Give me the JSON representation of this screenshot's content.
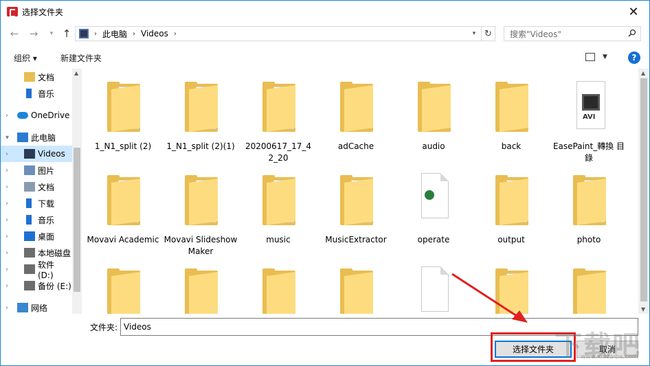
{
  "window": {
    "title": "选择文件夹",
    "close": "✕"
  },
  "address": {
    "location_root": "此电脑",
    "location_current": "Videos"
  },
  "search": {
    "placeholder": "搜索\"Videos\""
  },
  "toolbar": {
    "organize": "组织",
    "new_folder": "新建文件夹",
    "help": "?"
  },
  "nav": [
    {
      "label": "文档",
      "icon": "folder-icon"
    },
    {
      "label": "音乐",
      "icon": "music-note-icon"
    },
    {
      "label": "OneDrive",
      "icon": "cloud-icon"
    },
    {
      "label": "此电脑",
      "icon": "computer-icon"
    },
    {
      "label": "Videos",
      "icon": "film-icon",
      "selected": true
    },
    {
      "label": "图片",
      "icon": "pictures-icon"
    },
    {
      "label": "文档",
      "icon": "documents-icon"
    },
    {
      "label": "下载",
      "icon": "download-arrow-icon"
    },
    {
      "label": "音乐",
      "icon": "music-note-icon"
    },
    {
      "label": "桌面",
      "icon": "desktop-icon"
    },
    {
      "label": "本地磁盘",
      "icon": "drive-icon"
    },
    {
      "label": "软件 (D:)",
      "icon": "drive-icon"
    },
    {
      "label": "备份 (E:)",
      "icon": "drive-icon"
    },
    {
      "label": "网络",
      "icon": "network-icon"
    }
  ],
  "files": [
    {
      "name": "1_N1_split (2)",
      "type": "folder-image"
    },
    {
      "name": "1_N1_split (2)(1)",
      "type": "folder-image"
    },
    {
      "name": "20200617_17_4 2_20",
      "type": "folder-doc"
    },
    {
      "name": "adCache",
      "type": "folder"
    },
    {
      "name": "audio",
      "type": "folder"
    },
    {
      "name": "back",
      "type": "folder"
    },
    {
      "name": "EasePaint_轉換 目錄",
      "type": "avi"
    },
    {
      "name": "Movavi Academic",
      "type": "folder-doc"
    },
    {
      "name": "Movavi Slideshow Maker",
      "type": "folder-doc"
    },
    {
      "name": "music",
      "type": "folder-blank"
    },
    {
      "name": "MusicExtractor",
      "type": "folder-doc"
    },
    {
      "name": "operate",
      "type": "doc-stack"
    },
    {
      "name": "output",
      "type": "folder-doc"
    },
    {
      "name": "photo",
      "type": "folder-blank"
    },
    {
      "name": "",
      "type": "folder"
    },
    {
      "name": "",
      "type": "folder"
    },
    {
      "name": "",
      "type": "folder"
    },
    {
      "name": "",
      "type": "folder"
    },
    {
      "name": "",
      "type": "doc-stack"
    },
    {
      "name": "",
      "type": "folder-blank"
    },
    {
      "name": "",
      "type": "folder"
    }
  ],
  "footer": {
    "folder_label": "文件夹:",
    "folder_value": "Videos",
    "select_button": "选择文件夹",
    "cancel_button": "取消"
  },
  "watermark": {
    "text": "下载吧",
    "url": "www.xiazaiba.com"
  },
  "colors": {
    "accent": "#0078d7",
    "highlight": "#e02020",
    "folder": "#fddc80",
    "selection": "#cce8ff"
  }
}
